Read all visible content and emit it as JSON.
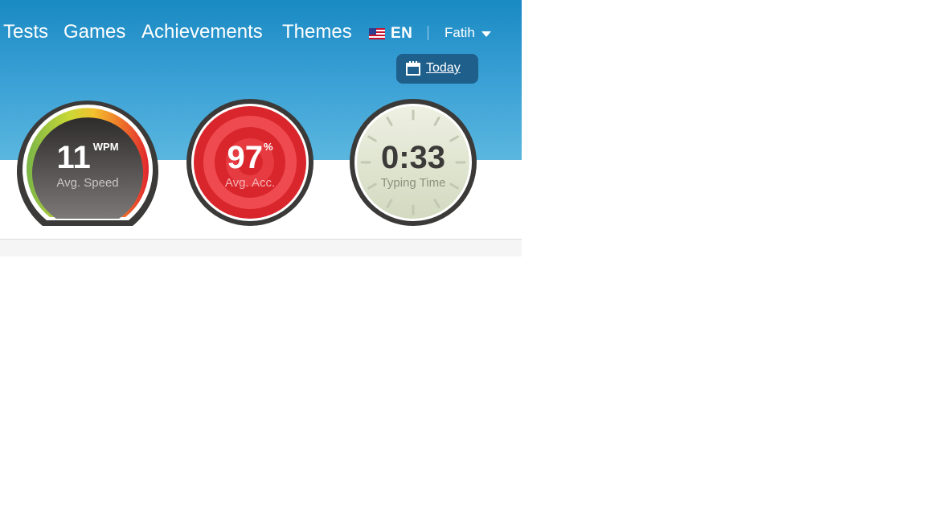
{
  "nav": {
    "items": [
      "Tests",
      "Games",
      "Achievements",
      "Themes"
    ],
    "language": "EN",
    "user": "Fatih"
  },
  "today_button": {
    "label": "Today"
  },
  "stats": {
    "speed": {
      "value": "11",
      "unit": "WPM",
      "label": "Avg. Speed"
    },
    "accuracy": {
      "value": "97",
      "unit": "%",
      "label": "Avg. Acc."
    },
    "time": {
      "value": "0:33",
      "label": "Typing Time"
    }
  },
  "colors": {
    "header_top": "#1a8ac3",
    "header_bottom": "#5bb7df",
    "accuracy_red": "#e23438",
    "speed_dark": "#3f3c3b",
    "time_bg": "#dde2cb",
    "today_button_bg": "#1f5f8c"
  },
  "icons": {
    "language_flag": "us-flag-icon",
    "user_menu": "chevron-down-icon",
    "today": "calendar-icon"
  }
}
